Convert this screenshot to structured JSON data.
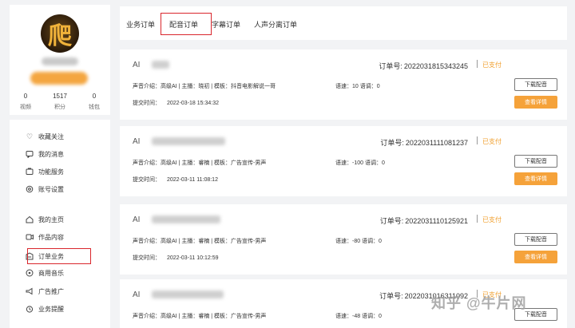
{
  "profile": {
    "avatar_glyph": "爬",
    "stats": [
      {
        "value": "0",
        "label": "视频"
      },
      {
        "value": "1517",
        "label": "积分"
      },
      {
        "value": "0",
        "label": "钱包"
      }
    ]
  },
  "menu": {
    "items": [
      {
        "label": "收藏关注",
        "icon": "heart-icon"
      },
      {
        "label": "我的消息",
        "icon": "message-icon"
      },
      {
        "label": "功能服务",
        "icon": "service-icon"
      },
      {
        "label": "账号设置",
        "icon": "settings-icon"
      },
      {
        "label": "我的主页",
        "icon": "home-icon"
      },
      {
        "label": "作品内容",
        "icon": "video-icon"
      },
      {
        "label": "订单业务",
        "icon": "order-icon"
      },
      {
        "label": "商用音乐",
        "icon": "music-icon"
      },
      {
        "label": "广告推广",
        "icon": "megaphone-icon"
      },
      {
        "label": "业务提醒",
        "icon": "alarm-icon"
      }
    ]
  },
  "tabs": [
    {
      "label": "业务订单"
    },
    {
      "label": "配音订单"
    },
    {
      "label": "字幕订单"
    },
    {
      "label": "人声分离订单"
    }
  ],
  "orders": [
    {
      "ai_label": "AI",
      "order_label": "订单号:",
      "order_no": "2022031815343245",
      "status": "已支付",
      "details": "声音介绍：高级AI | 主播：晓初 | 模板：抖音电影解说一哥",
      "speed": "语速：10   语调：0",
      "time_label": "提交时间：",
      "time": "2022-03-18 15:34:32",
      "download_label": "下载配音",
      "detail_label": "查看详情"
    },
    {
      "ai_label": "AI",
      "order_label": "订单号:",
      "order_no": "2022031111081237",
      "status": "已支付",
      "details": "声音介绍：高级AI | 主播：睿楠 | 模板：广告宣传-男声",
      "speed": "语速：-100   语调：0",
      "time_label": "提交时间：",
      "time": "2022-03-11 11:08:12",
      "download_label": "下载配音",
      "detail_label": "查看详情"
    },
    {
      "ai_label": "AI",
      "order_label": "订单号:",
      "order_no": "2022031110125921",
      "status": "已支付",
      "details": "声音介绍：高级AI | 主播：睿楠 | 模板：广告宣传-男声",
      "speed": "语速：-80   语调：0",
      "time_label": "提交时间：",
      "time": "2022-03-11 10:12:59",
      "download_label": "下载配音",
      "detail_label": "查看详情"
    },
    {
      "ai_label": "AI",
      "order_label": "订单号:",
      "order_no": "2022031016311092",
      "status": "已支付",
      "details": "声音介绍：高级AI | 主播：睿楠 | 模板：广告宣传-男声",
      "speed": "语速：-48   语调：0",
      "download_label": "下载配音"
    }
  ],
  "watermark": "知乎 @牛片网",
  "colors": {
    "accent": "#f5a23a",
    "highlight": "#d9262c",
    "background": "#f2f3f5"
  }
}
